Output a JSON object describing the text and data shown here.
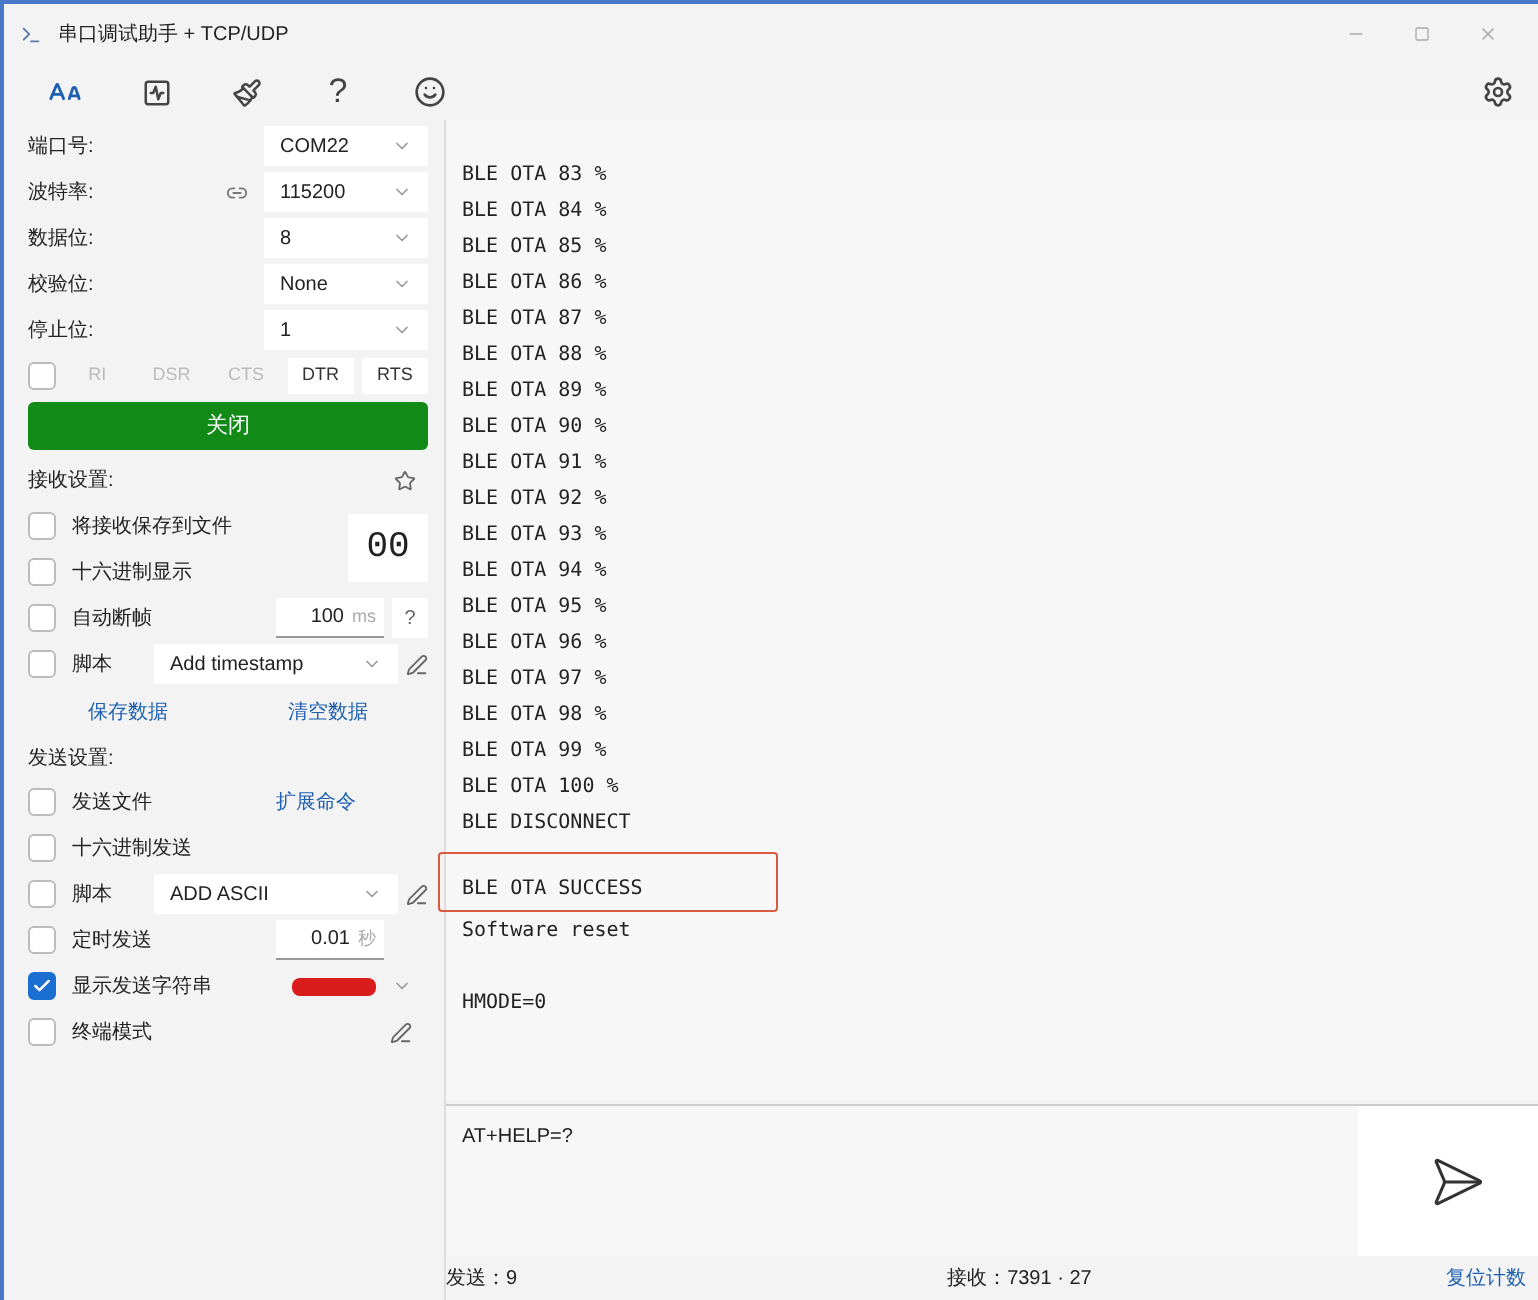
{
  "window": {
    "title": "串口调试助手 + TCP/UDP"
  },
  "toolbar": {
    "help": "?"
  },
  "serial": {
    "fields": [
      {
        "label": "端口号:",
        "value": "COM22",
        "icon": false
      },
      {
        "label": "波特率:",
        "value": "115200",
        "icon": true
      },
      {
        "label": "数据位:",
        "value": "8",
        "icon": false
      },
      {
        "label": "校验位:",
        "value": "None",
        "icon": false
      },
      {
        "label": "停止位:",
        "value": "1",
        "icon": false
      }
    ],
    "signals_checked": false,
    "signals": [
      {
        "label": "RI",
        "disabled": true
      },
      {
        "label": "DSR",
        "disabled": true
      },
      {
        "label": "CTS",
        "disabled": true
      },
      {
        "label": "DTR",
        "disabled": false
      },
      {
        "label": "RTS",
        "disabled": false
      }
    ],
    "open_button": "关闭"
  },
  "receive": {
    "title": "接收设置:",
    "hex_display": "00",
    "rows": [
      {
        "label": "将接收保存到文件",
        "checked": false,
        "control": {
          "kind": "none"
        }
      },
      {
        "label": "十六进制显示",
        "checked": false,
        "control": {
          "kind": "none"
        }
      },
      {
        "label": "自动断帧",
        "checked": false,
        "control": {
          "kind": "number",
          "value": "100",
          "unit": "ms",
          "help": "?"
        }
      },
      {
        "label": "脚本",
        "checked": false,
        "control": {
          "kind": "select",
          "value": "Add timestamp"
        }
      }
    ],
    "links": [
      "保存数据",
      "清空数据"
    ]
  },
  "send": {
    "title": "发送设置:",
    "rows": [
      {
        "label": "发送文件",
        "checked": false,
        "control": {
          "kind": "link",
          "value": "扩展命令"
        }
      },
      {
        "label": "十六进制发送",
        "checked": false,
        "control": {
          "kind": "none"
        }
      },
      {
        "label": "脚本",
        "checked": false,
        "control": {
          "kind": "select",
          "value": "ADD ASCII"
        }
      },
      {
        "label": "定时发送",
        "checked": false,
        "control": {
          "kind": "number",
          "value": "0.01",
          "unit": "秒"
        }
      },
      {
        "label": "显示发送字符串",
        "checked": true,
        "control": {
          "kind": "color",
          "color": "#d91c1c"
        }
      },
      {
        "label": "终端模式",
        "checked": false,
        "control": {
          "kind": "edit"
        }
      }
    ]
  },
  "log": [
    {
      "kind": "text",
      "text": "BLE OTA 83 %",
      "highlighted": false
    },
    {
      "kind": "text",
      "text": "BLE OTA 84 %",
      "highlighted": false
    },
    {
      "kind": "text",
      "text": "BLE OTA 85 %",
      "highlighted": false
    },
    {
      "kind": "text",
      "text": "BLE OTA 86 %",
      "highlighted": false
    },
    {
      "kind": "text",
      "text": "BLE OTA 87 %",
      "highlighted": false
    },
    {
      "kind": "text",
      "text": "BLE OTA 88 %",
      "highlighted": false
    },
    {
      "kind": "text",
      "text": "BLE OTA 89 %",
      "highlighted": false
    },
    {
      "kind": "text",
      "text": "BLE OTA 90 %",
      "highlighted": false
    },
    {
      "kind": "text",
      "text": "BLE OTA 91 %",
      "highlighted": false
    },
    {
      "kind": "text",
      "text": "BLE OTA 92 %",
      "highlighted": false
    },
    {
      "kind": "text",
      "text": "BLE OTA 93 %",
      "highlighted": false
    },
    {
      "kind": "text",
      "text": "BLE OTA 94 %",
      "highlighted": false
    },
    {
      "kind": "text",
      "text": "BLE OTA 95 %",
      "highlighted": false
    },
    {
      "kind": "text",
      "text": "BLE OTA 96 %",
      "highlighted": false
    },
    {
      "kind": "text",
      "text": "BLE OTA 97 %",
      "highlighted": false
    },
    {
      "kind": "text",
      "text": "BLE OTA 98 %",
      "highlighted": false
    },
    {
      "kind": "text",
      "text": "BLE OTA 99 %",
      "highlighted": false
    },
    {
      "kind": "text",
      "text": "BLE OTA 100 %",
      "highlighted": false
    },
    {
      "kind": "text",
      "text": "BLE DISCONNECT",
      "highlighted": false
    },
    {
      "kind": "blank"
    },
    {
      "kind": "text",
      "text": "BLE OTA SUCCESS",
      "highlighted": true
    },
    {
      "kind": "text",
      "text": "Software reset",
      "highlighted": false
    },
    {
      "kind": "blank"
    },
    {
      "kind": "text",
      "text": "HMODE=0",
      "highlighted": false
    }
  ],
  "input": {
    "value": "AT+HELP=?"
  },
  "status_bar": {
    "sent": "发送：9",
    "received": "接收：7391 · 27",
    "reset": "复位计数"
  }
}
